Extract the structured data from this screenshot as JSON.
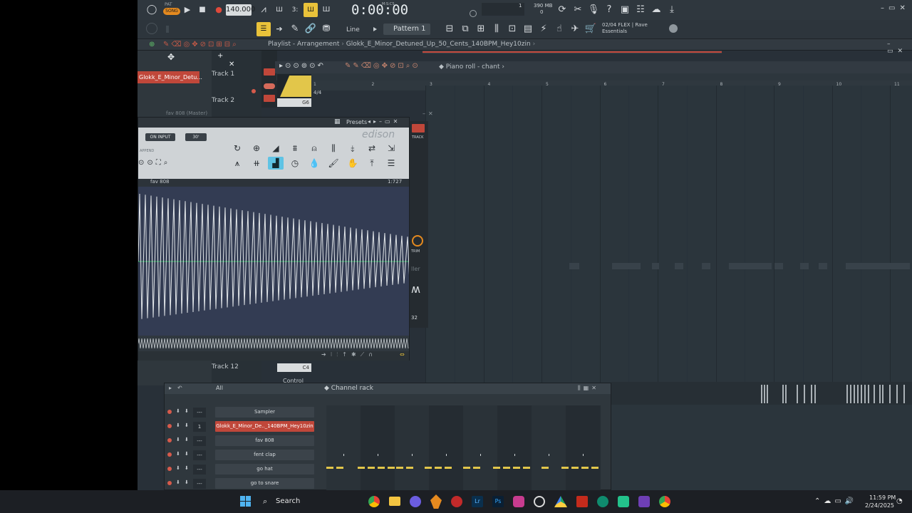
{
  "toolbar": {
    "pat_label": "PAT",
    "song_label": "SONG",
    "tempo": "140.000",
    "time": "0:00:00",
    "time_unit": "M:S:CS",
    "cpu_value": "1",
    "memory": "390 MB",
    "memory_sub": "0",
    "snap_mode": "Line",
    "pattern": "Pattern 1",
    "hint_line1": "02/04  FLEX | Rave",
    "hint_line2": "Essentials"
  },
  "playlist": {
    "title": "Playlist - Arrangement",
    "breadcrumb": "Glokk_E_Minor_Detuned_Up_50_Cents_140BPM_Hey10zin",
    "tracks": [
      "Track 1",
      "Track 2",
      "Track 12"
    ],
    "clip_label": "Glokk_E_Minor_Detu...",
    "mixer_label": "fav 808 (Master)",
    "note_g": "G6",
    "note_c": "C4",
    "control": "Control",
    "time_sig": "4/4"
  },
  "piano_roll": {
    "title": "Piano roll - chant",
    "bars": [
      "1",
      "2",
      "3",
      "4",
      "5",
      "6",
      "7",
      "8",
      "9",
      "10",
      "11"
    ]
  },
  "edison": {
    "presets_label": "Presets",
    "brand": "edison",
    "on_input": "ON INPUT",
    "duration": "30'",
    "append": "APPEND",
    "sample_name": "fav 808",
    "length": "1:727",
    "track_label": "TRACK",
    "trim_label": "TRIM",
    "ller": "ller",
    "count": "32"
  },
  "channel_rack": {
    "title": "Channel rack",
    "filter": "All",
    "channels": [
      {
        "name": "Sampler",
        "num": "---"
      },
      {
        "name": "Glokk_E_Minor_De.._140BPM_Hey10zin",
        "num": "1"
      },
      {
        "name": "fav 808",
        "num": "---"
      },
      {
        "name": "fent clap",
        "num": "---"
      },
      {
        "name": "go hat",
        "num": "---"
      },
      {
        "name": "go to snare",
        "num": "---"
      }
    ]
  },
  "taskbar": {
    "search": "Search",
    "time": "11:59 PM",
    "date": "2/24/2025"
  },
  "colors": {
    "accent_red": "#c0473a",
    "accent_blue": "#5fc3e4",
    "note_yellow": "#e2c64a"
  }
}
